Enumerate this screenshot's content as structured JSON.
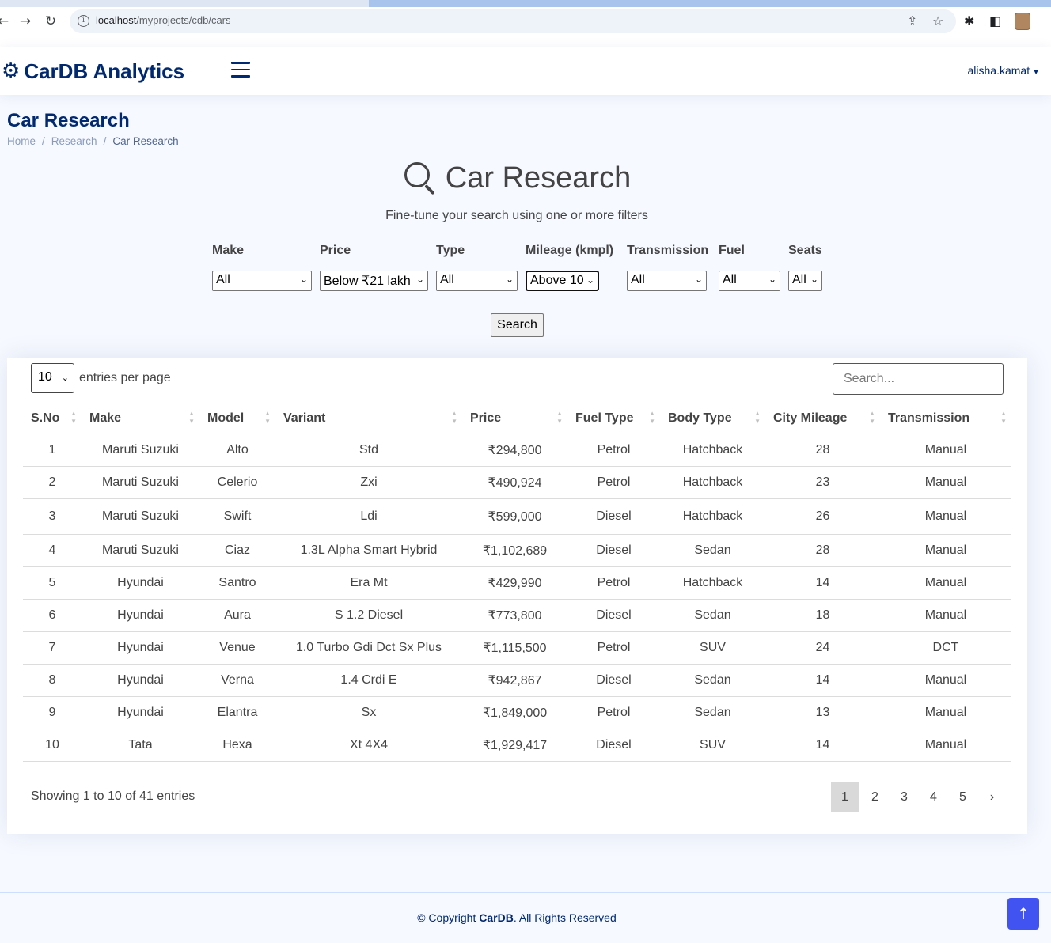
{
  "browser": {
    "url_host": "localhost",
    "url_path": "/myprojects/cdb/cars"
  },
  "header": {
    "brand": "CarDB Analytics",
    "user": "alisha.kamat"
  },
  "page": {
    "title": "Car Research",
    "breadcrumb": [
      "Home",
      "Research",
      "Car Research"
    ]
  },
  "research": {
    "heading": "Car Research",
    "subtitle": "Fine-tune your search using one or more filters",
    "search_button": "Search"
  },
  "filters": [
    {
      "label": "Make",
      "value": "All"
    },
    {
      "label": "Price",
      "value": "Below ₹21 lakh"
    },
    {
      "label": "Type",
      "value": "All"
    },
    {
      "label": "Mileage (kmpl)",
      "value": "Above 10"
    },
    {
      "label": "Transmission",
      "value": "All"
    },
    {
      "label": "Fuel",
      "value": "All"
    },
    {
      "label": "Seats",
      "value": "All"
    }
  ],
  "table_controls": {
    "per_page_value": "10",
    "per_page_label": "entries per page",
    "search_placeholder": "Search..."
  },
  "table": {
    "columns": [
      "S.No",
      "Make",
      "Model",
      "Variant",
      "Price",
      "Fuel Type",
      "Body Type",
      "City Mileage",
      "Transmission"
    ],
    "rows": [
      [
        "1",
        "Maruti Suzuki",
        "Alto",
        "Std",
        "₹294,800",
        "Petrol",
        "Hatchback",
        "28",
        "Manual"
      ],
      [
        "2",
        "Maruti Suzuki",
        "Celerio",
        "Zxi",
        "₹490,924",
        "Petrol",
        "Hatchback",
        "23",
        "Manual"
      ],
      [
        "3",
        "Maruti Suzuki",
        "Swift",
        "Ldi",
        "₹599,000",
        "Diesel",
        "Hatchback",
        "26",
        "Manual"
      ],
      [
        "4",
        "Maruti Suzuki",
        "Ciaz",
        "1.3L Alpha Smart Hybrid",
        "₹1,102,689",
        "Diesel",
        "Sedan",
        "28",
        "Manual"
      ],
      [
        "5",
        "Hyundai",
        "Santro",
        "Era Mt",
        "₹429,990",
        "Petrol",
        "Hatchback",
        "14",
        "Manual"
      ],
      [
        "6",
        "Hyundai",
        "Aura",
        "S 1.2 Diesel",
        "₹773,800",
        "Diesel",
        "Sedan",
        "18",
        "Manual"
      ],
      [
        "7",
        "Hyundai",
        "Venue",
        "1.0 Turbo Gdi Dct Sx Plus",
        "₹1,115,500",
        "Petrol",
        "SUV",
        "24",
        "DCT"
      ],
      [
        "8",
        "Hyundai",
        "Verna",
        "1.4 Crdi E",
        "₹942,867",
        "Diesel",
        "Sedan",
        "14",
        "Manual"
      ],
      [
        "9",
        "Hyundai",
        "Elantra",
        "Sx",
        "₹1,849,000",
        "Petrol",
        "Sedan",
        "13",
        "Manual"
      ],
      [
        "10",
        "Tata",
        "Hexa",
        "Xt 4X4",
        "₹1,929,417",
        "Diesel",
        "SUV",
        "14",
        "Manual"
      ]
    ]
  },
  "pagination": {
    "showing": "Showing 1 to 10 of 41 entries",
    "pages": [
      "1",
      "2",
      "3",
      "4",
      "5"
    ],
    "next": "›",
    "current": "1"
  },
  "footer": {
    "prefix": "© Copyright ",
    "brand": "CarDB",
    "suffix": ". All Rights Reserved"
  },
  "colors": {
    "brand": "#012970",
    "accent": "#4154f1",
    "page_bg": "#f6f9ff"
  }
}
